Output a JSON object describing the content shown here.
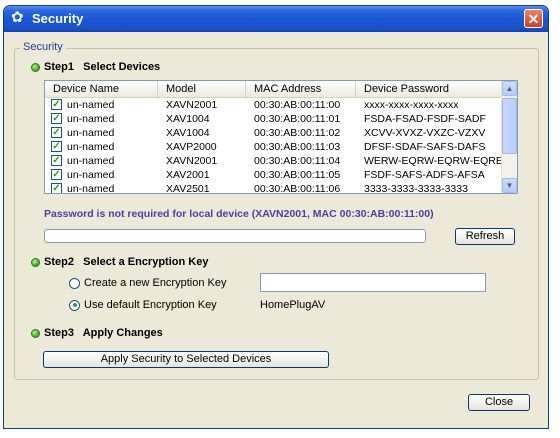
{
  "window": {
    "title": "Security",
    "close_glyph": "✕"
  },
  "group": {
    "legend": "Security"
  },
  "step1": {
    "label": "Step1   Select Devices"
  },
  "table": {
    "columns": [
      "Device Name",
      "Model",
      "MAC Address",
      "Device Password"
    ],
    "rows": [
      {
        "checked": true,
        "name": "un-named",
        "model": "XAVN2001",
        "mac": "00:30:AB:00:11:00",
        "password": "xxxx-xxxx-xxxx-xxxx"
      },
      {
        "checked": true,
        "name": "un-named",
        "model": "XAV1004",
        "mac": "00:30:AB:00:11:01",
        "password": "FSDA-FSAD-FSDF-SADF"
      },
      {
        "checked": true,
        "name": "un-named",
        "model": "XAV1004",
        "mac": "00:30:AB:00:11:02",
        "password": "XCVV-XVXZ-VXZC-VZXV"
      },
      {
        "checked": true,
        "name": "un-named",
        "model": "XAVP2000",
        "mac": "00:30:AB:00:11:03",
        "password": "DFSF-SDAF-SAFS-DAFS"
      },
      {
        "checked": true,
        "name": "un-named",
        "model": "XAVN2001",
        "mac": "00:30:AB:00:11:04",
        "password": "WERW-EQRW-EQRW-EQRE"
      },
      {
        "checked": true,
        "name": "un-named",
        "model": "XAV2001",
        "mac": "00:30:AB:00:11:05",
        "password": "FSDF-SAFS-ADFS-AFSA"
      },
      {
        "checked": true,
        "name": "un-named",
        "model": "XAV2501",
        "mac": "00:30:AB:00:11:06",
        "password": "3333-3333-3333-3333"
      }
    ]
  },
  "notice": "Password is not required for local device (XAVN2001, MAC 00:30:AB:00:11:00)",
  "refresh_label": "Refresh",
  "step2": {
    "label": "Step2   Select a Encryption Key",
    "option_new": "Create a new Encryption Key",
    "option_default": "Use default Encryption Key",
    "selected": "default",
    "new_key_value": "",
    "default_key": "HomePlugAV"
  },
  "step3": {
    "label": "Step3   Apply Changes",
    "apply_label": "Apply Security to Selected Devices"
  },
  "close_label": "Close",
  "progress": 0,
  "colors": {
    "title_bar": "#1a56d4",
    "notice_text": "#4b3fa3",
    "step_dot": "#3da317"
  }
}
